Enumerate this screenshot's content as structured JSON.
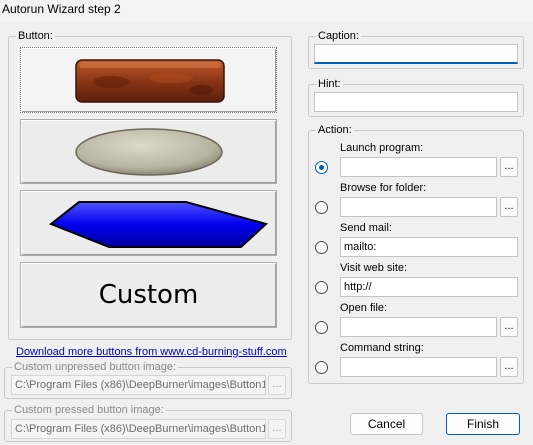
{
  "window": {
    "title": "Autorun Wizard step 2"
  },
  "button_group": {
    "label": "Button:",
    "previews": [
      {
        "style": "brick",
        "selected": true
      },
      {
        "style": "stone-ellipse",
        "selected": false
      },
      {
        "style": "blue-hexagon",
        "selected": false
      },
      {
        "style": "custom",
        "text": "Custom",
        "selected": false
      }
    ]
  },
  "download_link": "Download more buttons from www.cd-burning-stuff.com",
  "unpressed": {
    "label": "Custom unpressed button image:",
    "value": "C:\\Program Files (x86)\\DeepBurner\\images\\Button1.",
    "browse": "..."
  },
  "pressed": {
    "label": "Custom pressed button image:",
    "value": "C:\\Program Files (x86)\\DeepBurner\\images\\Button1I",
    "browse": "..."
  },
  "caption": {
    "label": "Caption:",
    "value": ""
  },
  "hint": {
    "label": "Hint:",
    "value": ""
  },
  "action": {
    "label": "Action:",
    "options": [
      {
        "label": "Launch program:",
        "value": "",
        "has_browse": true,
        "checked": true
      },
      {
        "label": "Browse for folder:",
        "value": "",
        "has_browse": true,
        "checked": false
      },
      {
        "label": "Send mail:",
        "value": "mailto:",
        "has_browse": false,
        "checked": false
      },
      {
        "label": "Visit web site:",
        "value": "http://",
        "has_browse": false,
        "checked": false
      },
      {
        "label": "Open file:",
        "value": "",
        "has_browse": true,
        "checked": false
      },
      {
        "label": "Command string:",
        "value": "",
        "has_browse": true,
        "checked": false
      }
    ],
    "browse": "..."
  },
  "buttons": {
    "cancel": "Cancel",
    "finish": "Finish"
  },
  "colors": {
    "accent": "#005fb8",
    "link": "#0000c0"
  }
}
